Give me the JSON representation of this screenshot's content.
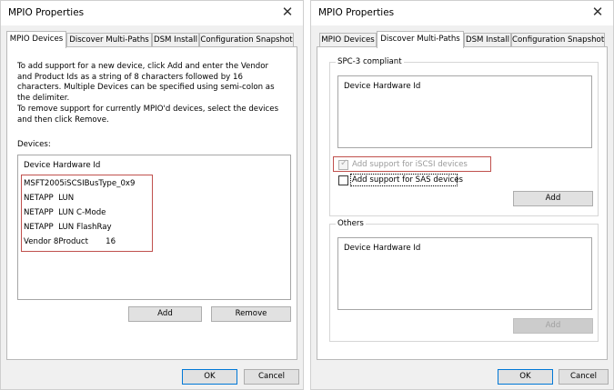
{
  "left_dialog": {
    "title": "MPIO Properties",
    "close_glyph": "✕",
    "tabs": [
      "MPIO Devices",
      "Discover Multi-Paths",
      "DSM Install",
      "Configuration Snapshot"
    ],
    "active_tab": "MPIO Devices",
    "instructions_add": "To add support for a new device, click Add and enter the Vendor and Product Ids as a string of 8 characters followed by 16 characters. Multiple Devices can be specified using semi-colon as the delimiter.",
    "instructions_remove": "To remove support for currently MPIO'd devices, select the devices and then click Remove.",
    "devices_label": "Devices:",
    "list_header": "Device Hardware Id",
    "devices": [
      "MSFT2005iSCSIBusType_0x9",
      "NETAPP  LUN",
      "NETAPP  LUN C-Mode",
      "NETAPP  LUN FlashRay",
      "Vendor 8Product       16"
    ],
    "add_button": "Add",
    "remove_button": "Remove",
    "ok_button": "OK",
    "cancel_button": "Cancel"
  },
  "right_dialog": {
    "title": "MPIO Properties",
    "close_glyph": "✕",
    "tabs": [
      "MPIO Devices",
      "Discover Multi-Paths",
      "DSM Install",
      "Configuration Snapshot"
    ],
    "active_tab": "Discover Multi-Paths",
    "spc3_group": "SPC-3 compliant",
    "spc3_list_header": "Device Hardware Id",
    "iscsi_checkbox": "Add support for iSCSI devices",
    "iscsi_checked": true,
    "sas_checkbox": "Add support for SAS devices",
    "sas_checked": false,
    "spc3_add_button": "Add",
    "others_group": "Others",
    "others_list_header": "Device Hardware Id",
    "others_add_button": "Add",
    "ok_button": "OK",
    "cancel_button": "Cancel"
  },
  "colors": {
    "highlight": "#c0504d",
    "focus": "#0078d7"
  }
}
